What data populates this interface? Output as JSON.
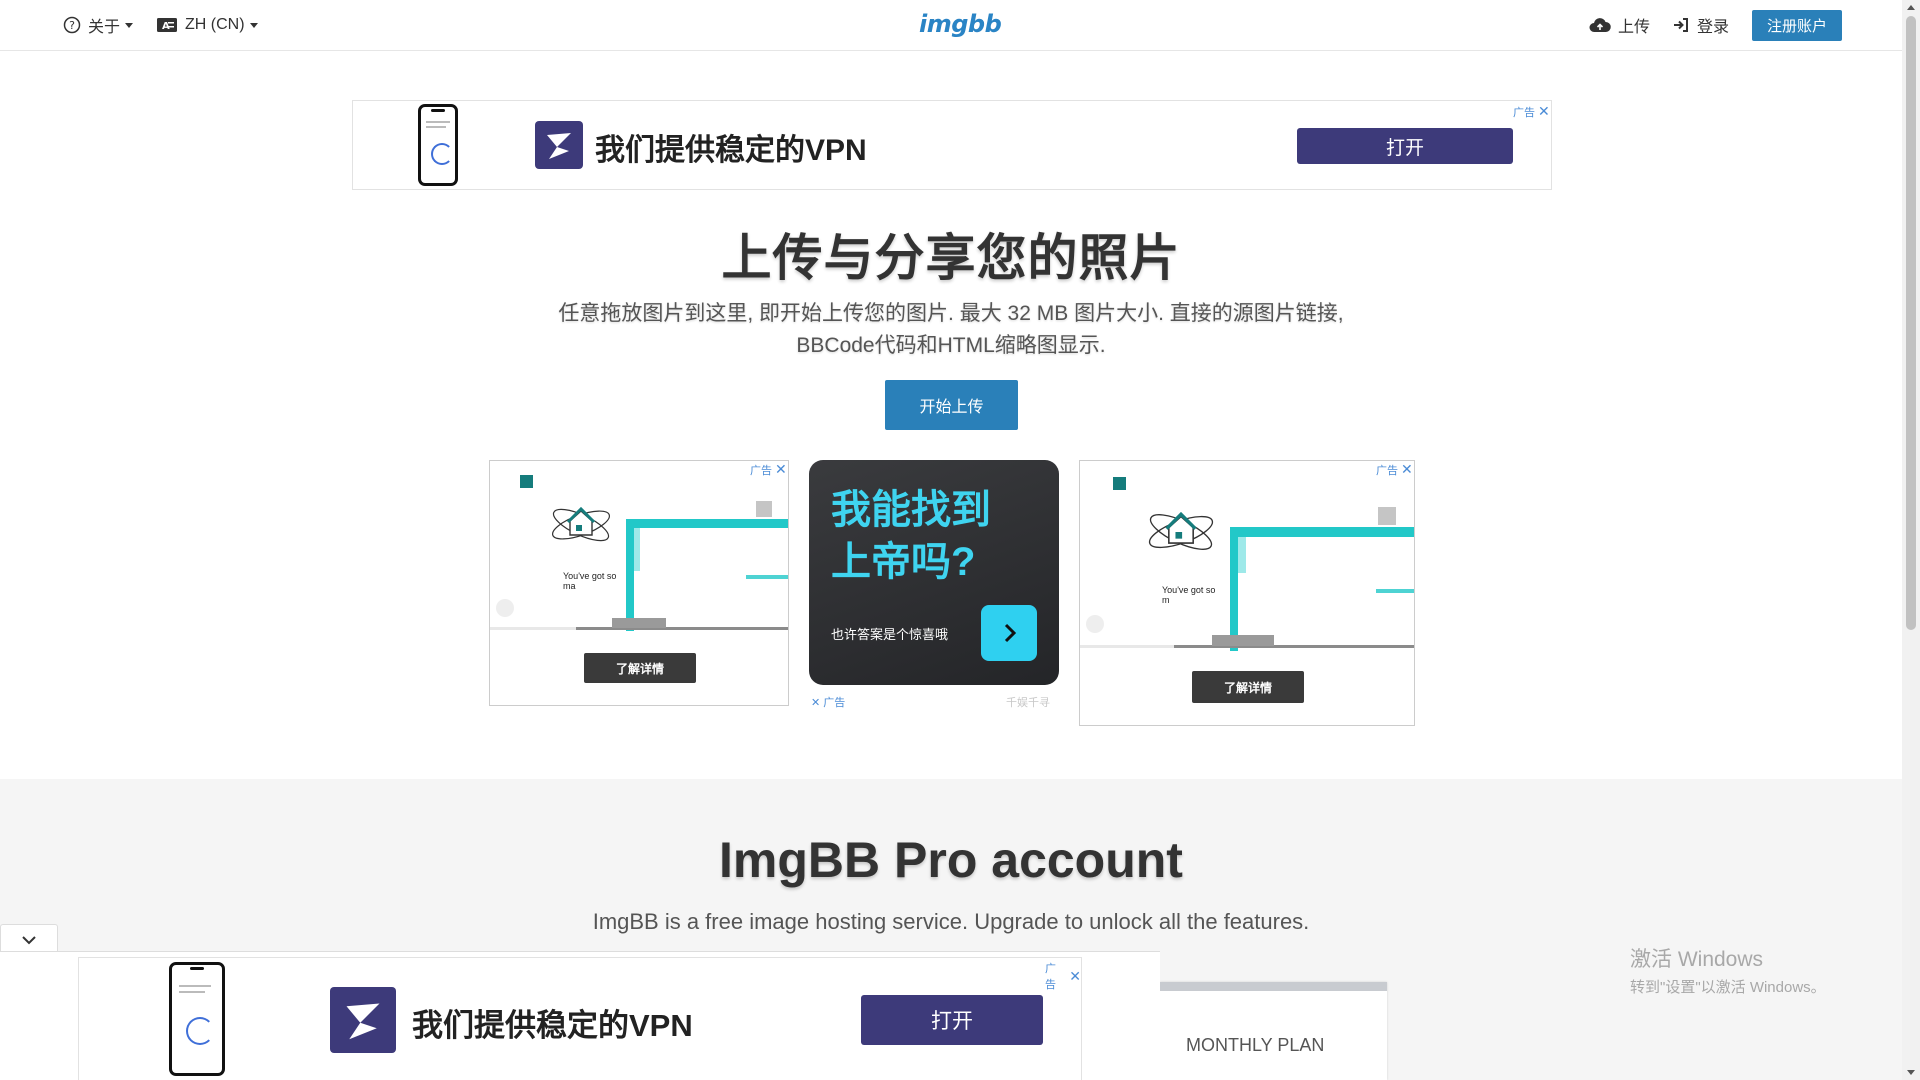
{
  "nav": {
    "about_label": "关于",
    "language_label": "ZH (CN)",
    "logo_text": "imgbb",
    "upload_label": "上传",
    "login_label": "登录",
    "signup_label": "注册账户"
  },
  "top_ad": {
    "flag_label": "广告",
    "headline": "我们提供稳定的VPN",
    "button_label": "打开"
  },
  "hero": {
    "title": "上传与分享您的照片",
    "description": "任意拖放图片到这里, 即开始上传您的图片. 最大 32 MB 图片大小. 直接的源图片链接, BBCode代码和HTML缩略图显示.",
    "start_button": "开始上传"
  },
  "game_ad_left": {
    "flag_label": "广告",
    "caption": "You've got so ma",
    "button_label": "了解详情"
  },
  "god_ad": {
    "title_line1": "我能找到",
    "title_line2": "上帝吗?",
    "subtitle": "也许答案是个惊喜哦",
    "flag_label": "广告",
    "brand_label": "千娱千寻"
  },
  "game_ad_right": {
    "flag_label": "广告",
    "caption": "You've got so m",
    "button_label": "了解详情"
  },
  "pro": {
    "title": "ImgBB Pro account",
    "description": "ImgBB is a free image hosting service. Upgrade to unlock all the features.",
    "plan_label": "MONTHLY PLAN"
  },
  "bottom_ad": {
    "flag_label": "广告",
    "headline": "我们提供稳定的VPN",
    "button_label": "打开"
  },
  "windows_watermark": {
    "line1": "激活 Windows",
    "line2": "转到\"设置\"以激活 Windows。"
  },
  "colors": {
    "accent": "#2a80b9",
    "vpn_brand": "#3d3a7a",
    "teal": "#22c8c8",
    "god_ad_cyan": "#3fd4f0"
  }
}
